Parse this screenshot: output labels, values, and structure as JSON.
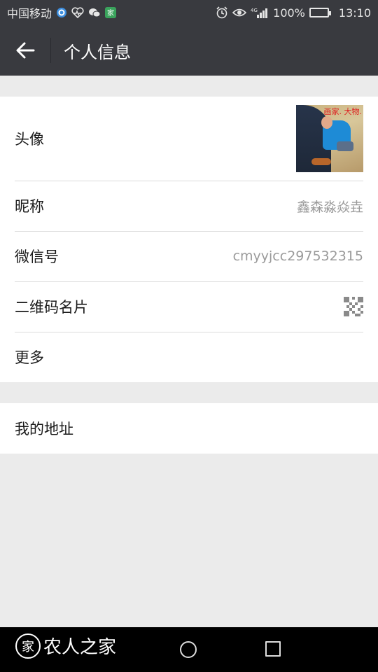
{
  "status_bar": {
    "carrier": "中国移动",
    "network": "4G",
    "battery": "100%",
    "time": "13:10",
    "icons": [
      "search-app-icon",
      "health-icon",
      "wechat-icon",
      "app-icon",
      "alarm-icon",
      "eye-icon",
      "signal-icon",
      "battery-icon"
    ]
  },
  "header": {
    "title": "个人信息",
    "back_icon": "arrow-left-icon"
  },
  "profile": {
    "avatar": {
      "label": "头像",
      "image_text": "画家. 大物."
    },
    "nickname": {
      "label": "昵称",
      "value": "鑫森淼焱垚"
    },
    "wechat_id": {
      "label": "微信号",
      "value": "cmyyjcc297532315"
    },
    "qr_code": {
      "label": "二维码名片",
      "icon": "qr-code-icon"
    },
    "more": {
      "label": "更多"
    }
  },
  "address": {
    "label": "我的地址"
  },
  "watermark": {
    "logo_char": "家",
    "text": "农人之家"
  },
  "nav": {
    "home_icon": "circle-home-icon",
    "recents_icon": "square-recents-icon"
  },
  "colors": {
    "title_bar": "#393a3f",
    "background": "#ebebeb",
    "card": "#ffffff",
    "divider": "#dcdcdc",
    "secondary_text": "#9a9a9a"
  }
}
